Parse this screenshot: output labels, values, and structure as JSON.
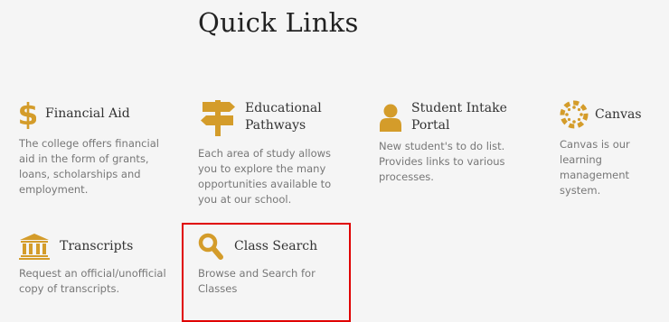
{
  "heading": "Quick Links",
  "accent_color": "#d49c2a",
  "highlight_color": "#e00000",
  "cards": [
    {
      "icon": "dollar-icon",
      "title": "Financial Aid",
      "desc": "The college offers financial aid in the form of grants, loans, scholarships and employment."
    },
    {
      "icon": "signpost-icon",
      "title": "Educational Pathways",
      "desc": "Each area of study allows you to explore the many opportunities available to you at our school."
    },
    {
      "icon": "user-icon",
      "title": "Student Intake Portal",
      "desc": "New student's to do list. Provides links to various processes."
    },
    {
      "icon": "canvas-icon",
      "title": "Canvas",
      "desc": "Canvas is our learning management system."
    },
    {
      "icon": "institution-icon",
      "title": "Transcripts",
      "desc": "Request an official/unofficial copy of transcripts."
    },
    {
      "icon": "search-icon",
      "title": "Class Search",
      "desc": "Browse and Search for Classes"
    }
  ]
}
